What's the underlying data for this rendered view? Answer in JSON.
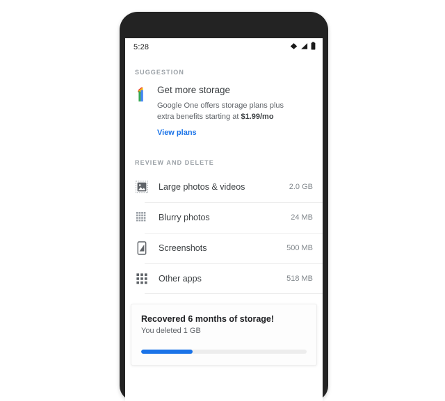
{
  "status_bar": {
    "time": "5:28",
    "icons": [
      "wifi-icon",
      "signal-icon",
      "battery-icon"
    ]
  },
  "suggestion": {
    "header": "SUGGESTION",
    "logo": "google-one-logo",
    "title": "Get more storage",
    "description_line1": "Google One offers storage plans plus",
    "description_line2_prefix": "extra benefits starting at ",
    "description_price": "$1.99/mo",
    "link_label": "View plans"
  },
  "review": {
    "header": "REVIEW AND DELETE",
    "items": [
      {
        "icon": "large-photos-icon",
        "label": "Large photos & videos",
        "size": "2.0 GB"
      },
      {
        "icon": "blurry-photos-icon",
        "label": "Blurry photos",
        "size": "24 MB"
      },
      {
        "icon": "screenshots-icon",
        "label": "Screenshots",
        "size": "500 MB"
      },
      {
        "icon": "other-apps-icon",
        "label": "Other apps",
        "size": "518 MB"
      }
    ]
  },
  "recovered": {
    "title": "Recovered 6 months of storage!",
    "subtitle": "You deleted 1 GB",
    "progress_percent": 31,
    "progress_color": "#1a73e8"
  },
  "colors": {
    "accent": "#1a73e8",
    "frame": "#232323",
    "primary_text": "#3c4043",
    "secondary_text": "#5f6368",
    "muted_text": "#9aa0a6"
  }
}
